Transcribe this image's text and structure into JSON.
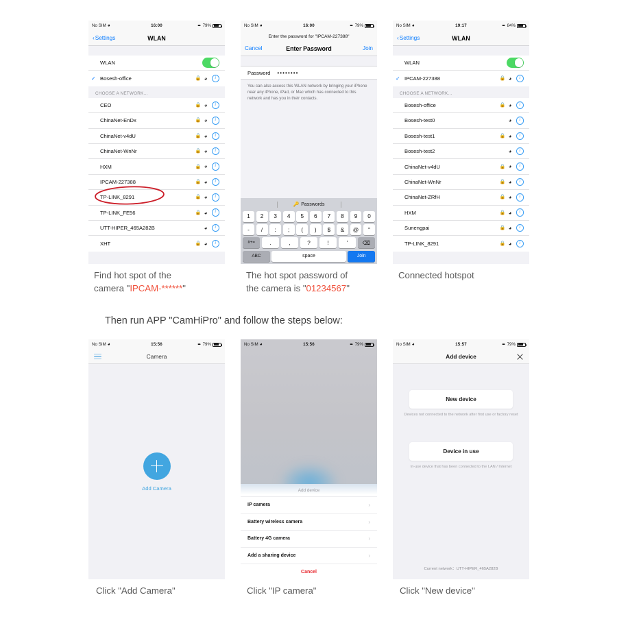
{
  "phones": {
    "wlan_list": {
      "status": {
        "carrier": "No SIM",
        "time": "16:00",
        "battery": "79%"
      },
      "nav": {
        "back": "Settings",
        "title": "WLAN"
      },
      "wlan_row": "WLAN",
      "connected": "Bosesh-office",
      "group_header": "CHOOSE A NETWORK...",
      "networks": [
        "CEO",
        "ChinaNet-EnDx",
        "ChinaNet-v4dU",
        "ChinaNet-WnNr",
        "HXM",
        "IPCAM-227388",
        "TP-LINK_8291",
        "TP-LINK_FE56",
        "UTT-HIPER_465A282B",
        "XHT"
      ],
      "highlighted_network": "IPCAM-227388"
    },
    "password": {
      "status": {
        "carrier": "No SIM",
        "time": "16:00",
        "battery": "79%"
      },
      "subtitle": "Enter the password for \"IPCAM-227388\"",
      "nav": {
        "cancel": "Cancel",
        "title": "Enter Password",
        "join": "Join"
      },
      "field_label": "Password",
      "field_value": "••••••••",
      "hint": "You can also access this WLAN network by bringing your iPhone near any iPhone, iPad, or Mac which has connected to this network and has you in their contacts.",
      "keyboard": {
        "bar_label": "Passwords",
        "bar_icon": "key-icon",
        "row1": [
          "1",
          "2",
          "3",
          "4",
          "5",
          "6",
          "7",
          "8",
          "9",
          "0"
        ],
        "row2": [
          "-",
          "/",
          ":",
          ";",
          "(",
          ")",
          "$",
          "&",
          "@",
          "\""
        ],
        "row3": [
          "#+=",
          ".",
          ",",
          "?",
          "!",
          "'",
          "⌫"
        ],
        "abc": "ABC",
        "space": "space",
        "join": "Join"
      }
    },
    "connected_list": {
      "status": {
        "carrier": "No SIM",
        "time": "19:17",
        "battery": "84%"
      },
      "nav": {
        "back": "Settings",
        "title": "WLAN"
      },
      "wlan_row": "WLAN",
      "connected": "IPCAM-227388",
      "group_header": "CHOOSE A NETWORK...",
      "networks": [
        "Bosesh-office",
        "Bosesh-test0",
        "Bosesh-test1",
        "Bosesh-test2",
        "ChinaNet-v4dU",
        "ChinaNet-WnNr",
        "ChinaNet-ZRfH",
        "HXM",
        "Sunengpai",
        "TP-LINK_8291"
      ]
    },
    "camera_app": {
      "status": {
        "carrier": "No SIM",
        "time": "15:56",
        "battery": "79%"
      },
      "menu_icon": "hamburger-menu-icon",
      "title": "Camera",
      "add_button_label": "Add Camera",
      "add_button_icon": "plus-icon"
    },
    "action_sheet": {
      "status": {
        "carrier": "No SIM",
        "time": "15:56",
        "battery": "79%"
      },
      "sheet_title": "Add device",
      "items": [
        "IP camera",
        "Battery wireless camera",
        "Battery 4G camera",
        "Add a sharing device"
      ],
      "cancel": "Cancel"
    },
    "add_device": {
      "status": {
        "carrier": "No SIM",
        "time": "15:57",
        "battery": "79%"
      },
      "title": "Add device",
      "close_icon": "close-icon",
      "new_device": {
        "label": "New device",
        "note": "Devices not connected to the network after first use or factory reset"
      },
      "device_in_use": {
        "label": "Device in use",
        "note": "In-use device that has been connected to the LAN / Internet"
      },
      "current_network": "Current network：UTT-HIPER_465A282B"
    }
  },
  "captions": {
    "step1_line1": "Find hot spot of the",
    "step1_line2_pre": "camera \"",
    "step1_line2_hl": "IPCAM-******",
    "step1_line2_post": "\"",
    "step2_line1": "The hot spot password of",
    "step2_line2_pre": "the camera is \"",
    "step2_line2_hl": "01234567",
    "step2_line2_post": "\"",
    "step3": "Connected hotspot",
    "lead": "Then run APP \"CamHiPro\" and follow the steps below:",
    "step4": "Click \"Add Camera\"",
    "step5": "Click \"IP camera\"",
    "step6": "Click \"New device\""
  },
  "colors": {
    "ios_blue": "#0a7cff",
    "toggle_green": "#4cd964",
    "accent_red": "#f0513c",
    "app_blue": "#42a6e0"
  }
}
